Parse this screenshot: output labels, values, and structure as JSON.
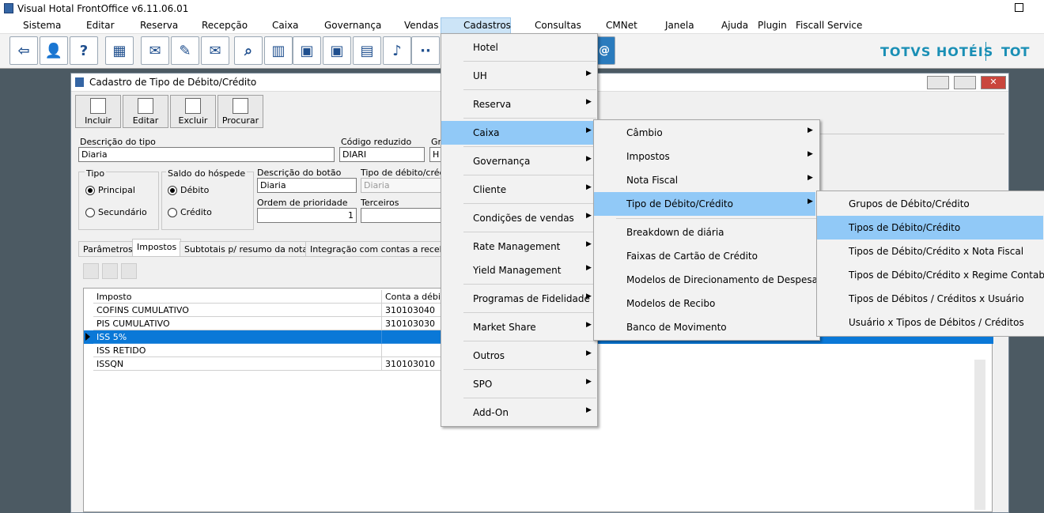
{
  "app": {
    "title": "Visual Hotal FrontOffice v6.11.06.01"
  },
  "menubar": [
    "Sistema",
    "Editar",
    "Reserva",
    "Recepção",
    "Caixa",
    "Governança",
    "Vendas",
    "Cadastros",
    "Consultas",
    "CMNet",
    "Janela",
    "Ajuda",
    "Plugin",
    "Fiscall Service"
  ],
  "toolbar": {
    "icons": [
      "exit-icon",
      "user-key-icon",
      "help-icon",
      "org-chart-icon",
      "mail-icon",
      "edit-grid-icon",
      "send-mail-icon",
      "search-icon",
      "calendar-icon",
      "guest-card-icon",
      "guest-card2-icon",
      "guest-list-icon",
      "bell-icon",
      "footprints-icon"
    ],
    "glyphs": [
      "⇦",
      "👤",
      "?",
      "▦",
      "✉",
      "✎",
      "✉",
      "⌕",
      "▥",
      "▣",
      "▣",
      "▤",
      "♪",
      "··"
    ]
  },
  "brand": {
    "name": "TOTVS HOTÉIS",
    "name2": "TOT"
  },
  "window": {
    "title": "Cadastro de Tipo de Débito/Crédito",
    "commands": [
      "Incluir",
      "Editar",
      "Excluir",
      "Procurar"
    ],
    "fields": {
      "descricao_label": "Descrição do tipo",
      "descricao_value": "Diaria",
      "codigo_label": "Código reduzido",
      "codigo_value": "DIARI",
      "gr_label": "Gr",
      "gr_value": "H",
      "tipo_label": "Tipo",
      "tipo_principal": "Principal",
      "tipo_secundario": "Secundário",
      "saldo_label": "Saldo do hóspede",
      "saldo_debito": "Débito",
      "saldo_credito": "Crédito",
      "botao_label": "Descrição do botão",
      "botao_value": "Diaria",
      "tipodc_label": "Tipo de débito/créd",
      "tipodc_value": "Diaria",
      "ordem_label": "Ordem de prioridade",
      "ordem_value": "1",
      "terceiros_label": "Terceiros",
      "terceiros_value": ""
    },
    "tabs": [
      "Parâmetros",
      "Impostos",
      "Subtotais p/ resumo da nota",
      "Integração com contas a receber"
    ],
    "grid": {
      "headers": [
        "Imposto",
        "Conta a débit"
      ],
      "rows": [
        {
          "imposto": "COFINS CUMULATIVO",
          "conta": "310103040"
        },
        {
          "imposto": "PIS CUMULATIVO",
          "conta": "310103030"
        },
        {
          "imposto": "ISS 5%",
          "conta": ""
        },
        {
          "imposto": "ISS RETIDO",
          "conta": ""
        },
        {
          "imposto": "ISSQN",
          "conta": "310103010"
        }
      ]
    }
  },
  "menus": {
    "cadastros": [
      "Hotel",
      "UH",
      "Reserva",
      "Caixa",
      "Governança",
      "Cliente",
      "Condições de vendas",
      "Rate Management",
      "Yield Management",
      "Programas de Fidelidade",
      "Market Share",
      "Outros",
      "SPO",
      "Add-On"
    ],
    "caixa": [
      "Câmbio",
      "Impostos",
      "Nota Fiscal",
      "Tipo de Débito/Crédito",
      "Breakdown de diária",
      "Faixas de Cartão de Crédito",
      "Modelos de Direcionamento de Despesas",
      "Modelos de Recibo",
      "Banco de Movimento"
    ],
    "tipo": [
      "Grupos de Débito/Crédito",
      "Tipos de Débito/Crédito",
      "Tipos de Débito/Crédito x Nota Fiscal",
      "Tipos de Débito/Crédito x Regime Contab.",
      "Tipos de Débitos / Créditos x Usuário",
      "Usuário x Tipos de Débitos / Créditos"
    ]
  }
}
